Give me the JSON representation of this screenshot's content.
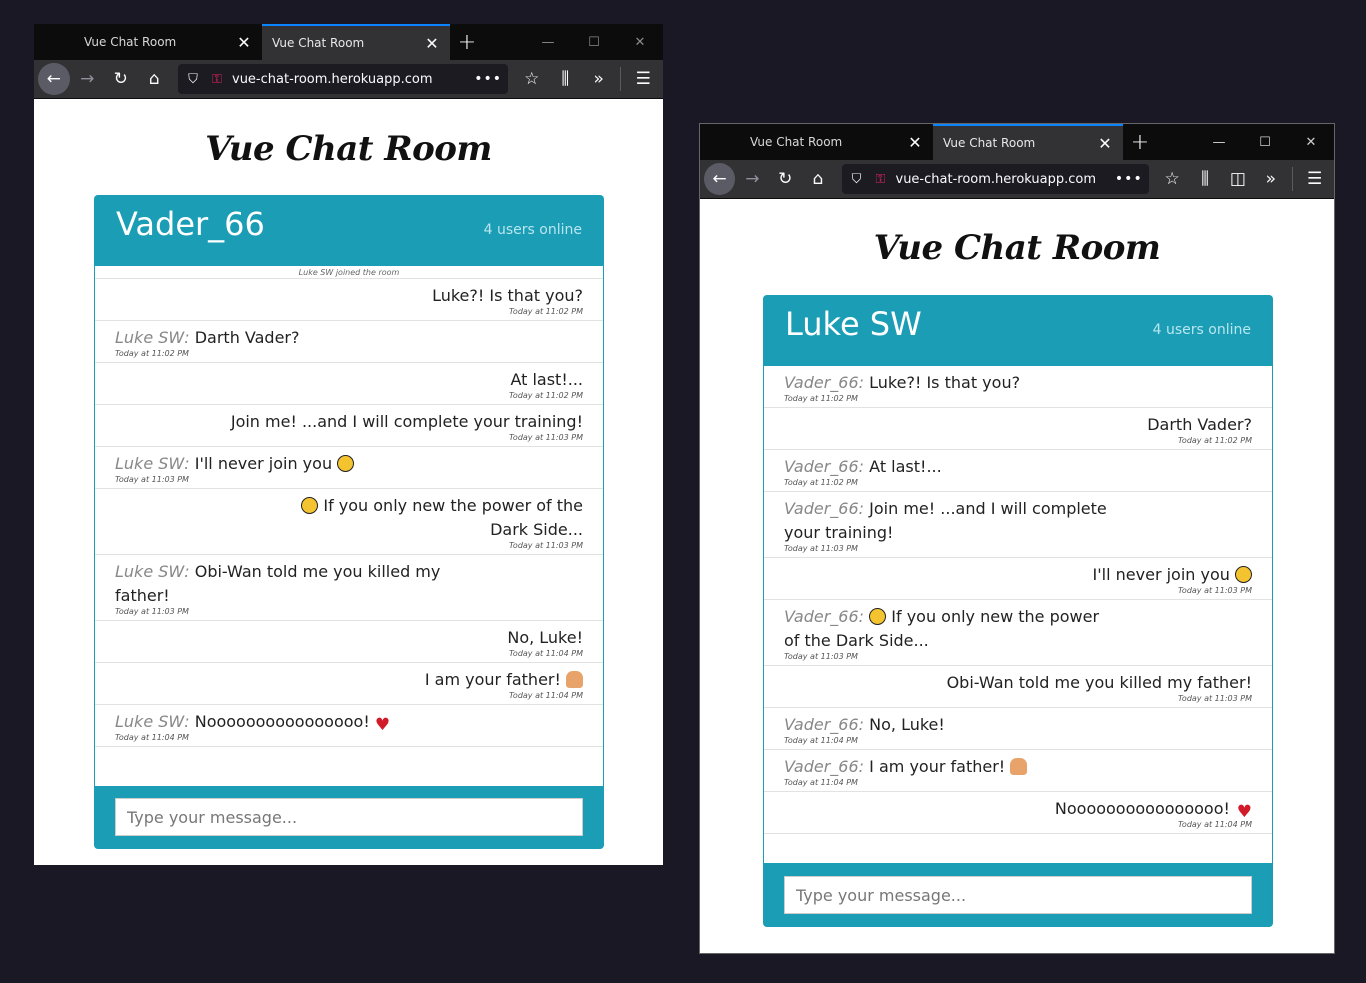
{
  "browser": {
    "tab_title": "Vue Chat Room",
    "url": "vue-chat-room.herokuapp.com",
    "url_more": "•••"
  },
  "left_window": {
    "app_title": "Vue Chat Room",
    "username": "Vader_66",
    "online": "4 users online",
    "system_message": "Luke SW joined the room",
    "messages": [
      {
        "side": "right",
        "text": "Luke?! Is that you?",
        "time": "Today at 11:02 PM"
      },
      {
        "side": "left",
        "who": "Luke SW:",
        "text": "Darth Vader?",
        "time": "Today at 11:02 PM"
      },
      {
        "side": "right",
        "text": "At last!...",
        "time": "Today at 11:02 PM"
      },
      {
        "side": "right",
        "text": "Join me! ...and I will complete your training!",
        "time": "Today at 11:03 PM"
      },
      {
        "side": "left",
        "who": "Luke SW:",
        "text": "I'll never join you",
        "time": "Today at 11:03 PM"
      },
      {
        "side": "right",
        "text": "If you only new the power of the Dark Side...",
        "time": "Today at 11:03 PM"
      },
      {
        "side": "left",
        "who": "Luke SW:",
        "text": "Obi-Wan told me you killed my father!",
        "time": "Today at 11:03 PM"
      },
      {
        "side": "right",
        "text": "No, Luke!",
        "time": "Today at 11:04 PM"
      },
      {
        "side": "right",
        "text": "I am your father!",
        "time": "Today at 11:04 PM"
      },
      {
        "side": "left",
        "who": "Luke SW:",
        "text": "Noooooooooooooooo!",
        "time": "Today at 11:04 PM"
      }
    ],
    "input_placeholder": "Type your message..."
  },
  "right_window": {
    "app_title": "Vue Chat Room",
    "username": "Luke SW",
    "online": "4 users online",
    "messages": [
      {
        "side": "left",
        "who": "Vader_66:",
        "text": "Luke?! Is that you?",
        "time": "Today at 11:02 PM"
      },
      {
        "side": "right",
        "text": "Darth Vader?",
        "time": "Today at 11:02 PM"
      },
      {
        "side": "left",
        "who": "Vader_66:",
        "text": "At last!...",
        "time": "Today at 11:02 PM"
      },
      {
        "side": "left",
        "who": "Vader_66:",
        "text": "Join me! ...and I will complete your training!",
        "time": "Today at 11:03 PM"
      },
      {
        "side": "right",
        "text": "I'll never join you",
        "time": "Today at 11:03 PM"
      },
      {
        "side": "left",
        "who": "Vader_66:",
        "text": "If you only new the power of the Dark Side...",
        "time": "Today at 11:03 PM"
      },
      {
        "side": "right",
        "text": "Obi-Wan told me you killed my father!",
        "time": "Today at 11:03 PM"
      },
      {
        "side": "left",
        "who": "Vader_66:",
        "text": "No, Luke!",
        "time": "Today at 11:04 PM"
      },
      {
        "side": "left",
        "who": "Vader_66:",
        "text": "I am your father!",
        "time": "Today at 11:04 PM"
      },
      {
        "side": "right",
        "text": "Noooooooooooooooo!",
        "time": "Today at 11:04 PM"
      }
    ],
    "input_placeholder": "Type your message..."
  },
  "colors": {
    "accent": "#1a9db5",
    "tab_highlight": "#0a84ff",
    "chrome": "#323234"
  }
}
